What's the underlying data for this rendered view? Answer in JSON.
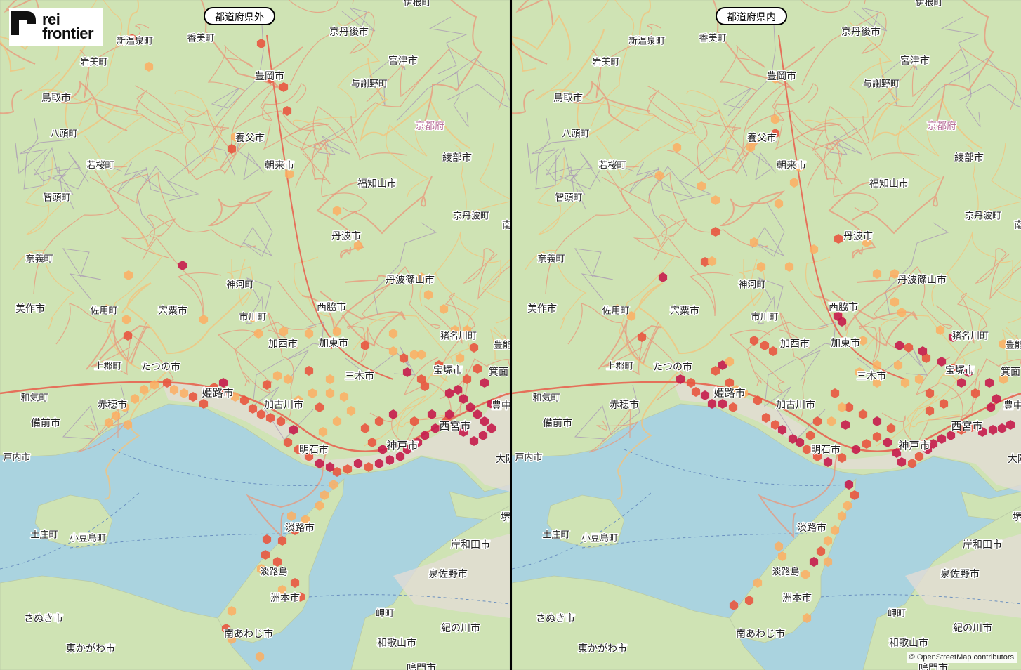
{
  "logo": {
    "line1": "rei",
    "line2": "frontier"
  },
  "panels": [
    {
      "id": "left",
      "title": "都道府県外"
    },
    {
      "id": "right",
      "title": "都道府県内"
    }
  ],
  "attribution": "© OpenStreetMap contributors",
  "palette": {
    "water": "#aad3df",
    "land": "#cfe3b4",
    "urban": "#e2dcd4",
    "road": "#e9967a",
    "hex_low": "#fff0a6",
    "hex_mid": "#fdae61",
    "hex_high": "#e8553f",
    "hex_top": "#c51b4b"
  },
  "places": [
    {
      "name": "伊根町"
    },
    {
      "name": "新温泉町"
    },
    {
      "name": "香美町"
    },
    {
      "name": "京丹後市"
    },
    {
      "name": "岩美町"
    },
    {
      "name": "宮津市"
    },
    {
      "name": "豊岡市"
    },
    {
      "name": "与謝野町"
    },
    {
      "name": "鳥取市"
    },
    {
      "name": "京都府"
    },
    {
      "name": "八頭町"
    },
    {
      "name": "養父市"
    },
    {
      "name": "綾部市"
    },
    {
      "name": "若桜町"
    },
    {
      "name": "朝来市"
    },
    {
      "name": "智頭町"
    },
    {
      "name": "福知山市"
    },
    {
      "name": "京丹波町"
    },
    {
      "name": "南"
    },
    {
      "name": "丹波市"
    },
    {
      "name": "奈義町"
    },
    {
      "name": "神河町"
    },
    {
      "name": "丹波篠山市"
    },
    {
      "name": "美作市"
    },
    {
      "name": "佐用町"
    },
    {
      "name": "宍粟市"
    },
    {
      "name": "市川町"
    },
    {
      "name": "西脇市"
    },
    {
      "name": "猪名川町"
    },
    {
      "name": "豊能"
    },
    {
      "name": "加西市"
    },
    {
      "name": "加東市"
    },
    {
      "name": "上郡町"
    },
    {
      "name": "たつの市"
    },
    {
      "name": "宝塚市"
    },
    {
      "name": "箕面"
    },
    {
      "name": "三木市"
    },
    {
      "name": "姫路市"
    },
    {
      "name": "和気町"
    },
    {
      "name": "赤穂市"
    },
    {
      "name": "加古川市"
    },
    {
      "name": "豊中"
    },
    {
      "name": "備前市"
    },
    {
      "name": "西宮市"
    },
    {
      "name": "明石市"
    },
    {
      "name": "神戸市"
    },
    {
      "name": "戸内市"
    },
    {
      "name": "大阪"
    },
    {
      "name": "堺"
    },
    {
      "name": "淡路市"
    },
    {
      "name": "土庄町"
    },
    {
      "name": "小豆島町"
    },
    {
      "name": "岸和田市"
    },
    {
      "name": "泉佐野市"
    },
    {
      "name": "淡路島"
    },
    {
      "name": "洲本市"
    },
    {
      "name": "さぬき市"
    },
    {
      "name": "岬町"
    },
    {
      "name": "紀の川市"
    },
    {
      "name": "南あわじ市"
    },
    {
      "name": "東かがわ市"
    },
    {
      "name": "和歌山市"
    },
    {
      "name": "鳴門市"
    }
  ]
}
